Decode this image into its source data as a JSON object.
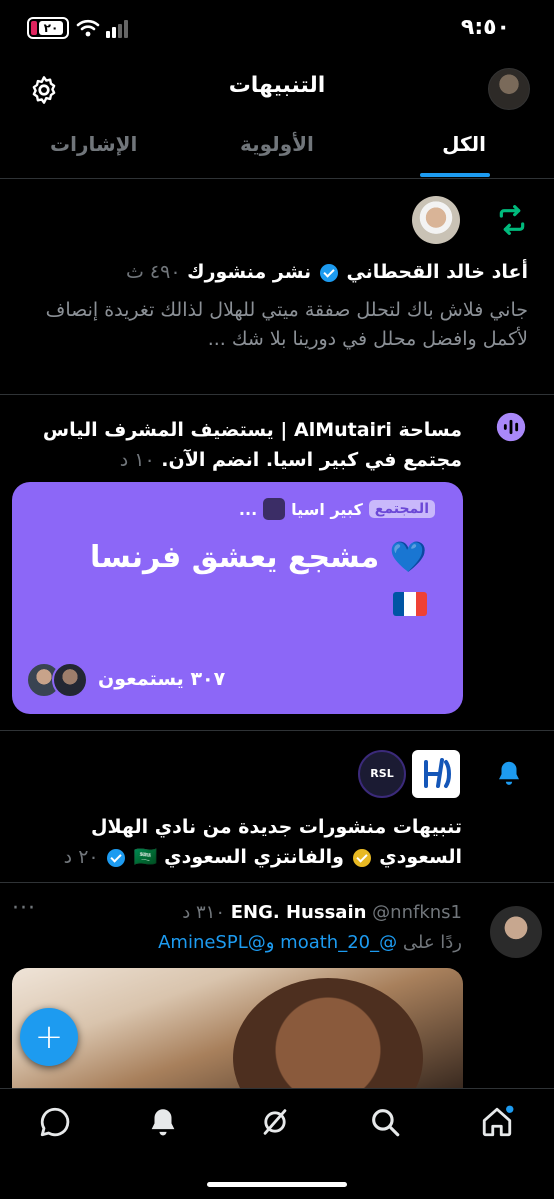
{
  "status_bar": {
    "time": "٩:٥٠",
    "battery": "٢٠"
  },
  "header": {
    "title": "التنبيهات"
  },
  "tabs": [
    {
      "label": "الكل",
      "active": true
    },
    {
      "label": "الأولوية",
      "active": false
    },
    {
      "label": "الإشارات",
      "active": false
    }
  ],
  "notif_retweet": {
    "prefix": "أعاد خالد القحطاني",
    "suffix": "نشر منشورك",
    "time": "٤٩٠ ث",
    "body": "جاني فلاش باك لتحلل صفقة ميتي للهلال لذالك تغريدة إنصاف لأكمل وافضل محلل في دورينا بلا شك ..."
  },
  "notif_space": {
    "text": "مساحة AlMutairi | يستضيف المشرف الياس مجتمع في كبير اسيا. انضم الآن.",
    "time": "١٠ د",
    "card": {
      "host": "كبير اسيا",
      "badge": "المجتمع",
      "more": "...",
      "title": "مشجع يعشق فرنسا 💙",
      "listeners": "٣٠٧ يستمعون"
    }
  },
  "notif_alerts": {
    "line1": "تنبيهات منشورات جديدة من نادي الهلال",
    "club": "السعودي",
    "and": "والفانتزي السعودي",
    "flag": "🇸🇦",
    "time": "٢٠ د",
    "rsl_label": "RSL"
  },
  "tweet": {
    "name": "ENG. Hussain",
    "handle": "@nnfkns1",
    "time": "٣١٠ د",
    "more": "···",
    "reply_prefix": "ردًا على",
    "mention1": "@_moath_20",
    "conj": "و",
    "mention2": "@AmineSPL"
  },
  "fab": {
    "label": "+"
  },
  "colors": {
    "accent": "#1d9bf0",
    "space": "#8c67f7",
    "retweet": "#00ba7c"
  }
}
